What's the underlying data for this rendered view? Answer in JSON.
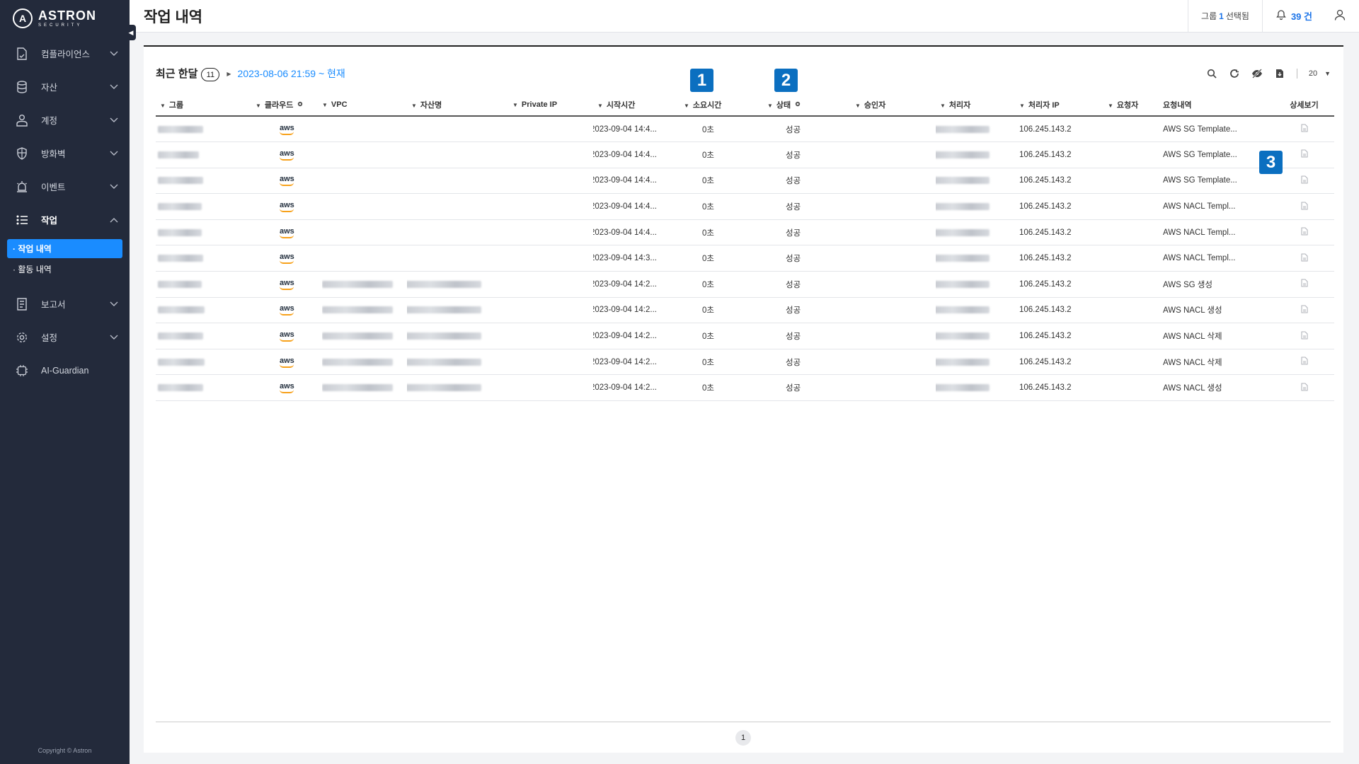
{
  "brand": {
    "name": "ASTRON",
    "sub": "SECURITY",
    "mark": "A"
  },
  "sidebar": {
    "items": [
      {
        "label": "컴플라이언스",
        "icon": "compliance-icon"
      },
      {
        "label": "자산",
        "icon": "database-icon"
      },
      {
        "label": "계정",
        "icon": "account-icon"
      },
      {
        "label": "방화벽",
        "icon": "shield-icon"
      },
      {
        "label": "이벤트",
        "icon": "alarm-icon"
      },
      {
        "label": "작업",
        "icon": "task-list-icon",
        "active": true
      }
    ],
    "sub_items": [
      {
        "label": "· 작업 내역",
        "active": true
      },
      {
        "label": "· 활동 내역"
      }
    ],
    "items_after": [
      {
        "label": "보고서",
        "icon": "report-icon"
      },
      {
        "label": "설정",
        "icon": "gear-icon"
      },
      {
        "label": "AI-Guardian",
        "icon": "chip-icon"
      }
    ],
    "copyright": "Copyright © Astron"
  },
  "header": {
    "title": "작업 내역",
    "group_prefix": "그룹",
    "group_count": "1",
    "group_suffix": "선택됨",
    "notice_count": "39 건"
  },
  "toolbar": {
    "period": "최근 한달",
    "count": "11",
    "range": "2023-08-06 21:59 ~ 현재",
    "page_size": "20"
  },
  "table": {
    "columns": [
      "그룹",
      "클라우드",
      "VPC",
      "자산명",
      "Private IP",
      "시작시간",
      "소요시간",
      "상태",
      "승인자",
      "처리자",
      "처리자 IP",
      "요청자",
      "요청내역",
      "상세보기"
    ],
    "rows": [
      {
        "cloud": "aws",
        "start": "2023-09-04 14:4...",
        "duration": "0초",
        "status": "성공",
        "ip": "106.245.143.2",
        "request": "AWS SG Template..."
      },
      {
        "cloud": "aws",
        "start": "2023-09-04 14:4...",
        "duration": "0초",
        "status": "성공",
        "ip": "106.245.143.2",
        "request": "AWS SG Template..."
      },
      {
        "cloud": "aws",
        "start": "2023-09-04 14:4...",
        "duration": "0초",
        "status": "성공",
        "ip": "106.245.143.2",
        "request": "AWS SG Template..."
      },
      {
        "cloud": "aws",
        "start": "2023-09-04 14:4...",
        "duration": "0초",
        "status": "성공",
        "ip": "106.245.143.2",
        "request": "AWS NACL Templ..."
      },
      {
        "cloud": "aws",
        "start": "2023-09-04 14:4...",
        "duration": "0초",
        "status": "성공",
        "ip": "106.245.143.2",
        "request": "AWS NACL Templ..."
      },
      {
        "cloud": "aws",
        "start": "2023-09-04 14:3...",
        "duration": "0초",
        "status": "성공",
        "ip": "106.245.143.2",
        "request": "AWS NACL Templ..."
      },
      {
        "cloud": "aws",
        "start": "2023-09-04 14:2...",
        "duration": "0초",
        "status": "성공",
        "ip": "106.245.143.2",
        "request": "AWS SG 생성"
      },
      {
        "cloud": "aws",
        "start": "2023-09-04 14:2...",
        "duration": "0초",
        "status": "성공",
        "ip": "106.245.143.2",
        "request": "AWS NACL 생성"
      },
      {
        "cloud": "aws",
        "start": "2023-09-04 14:2...",
        "duration": "0초",
        "status": "성공",
        "ip": "106.245.143.2",
        "request": "AWS NACL 삭제"
      },
      {
        "cloud": "aws",
        "start": "2023-09-04 14:2...",
        "duration": "0초",
        "status": "성공",
        "ip": "106.245.143.2",
        "request": "AWS NACL 삭제"
      },
      {
        "cloud": "aws",
        "start": "2023-09-04 14:2...",
        "duration": "0초",
        "status": "성공",
        "ip": "106.245.143.2",
        "request": "AWS NACL 생성"
      }
    ]
  },
  "pagination": {
    "current": "1"
  },
  "callouts": [
    "1",
    "2",
    "3"
  ],
  "colors": {
    "sidebar": "#232a3b",
    "accent": "#1a8cff",
    "callout": "#0b6fc0",
    "aws_orange": "#f7a11a"
  }
}
